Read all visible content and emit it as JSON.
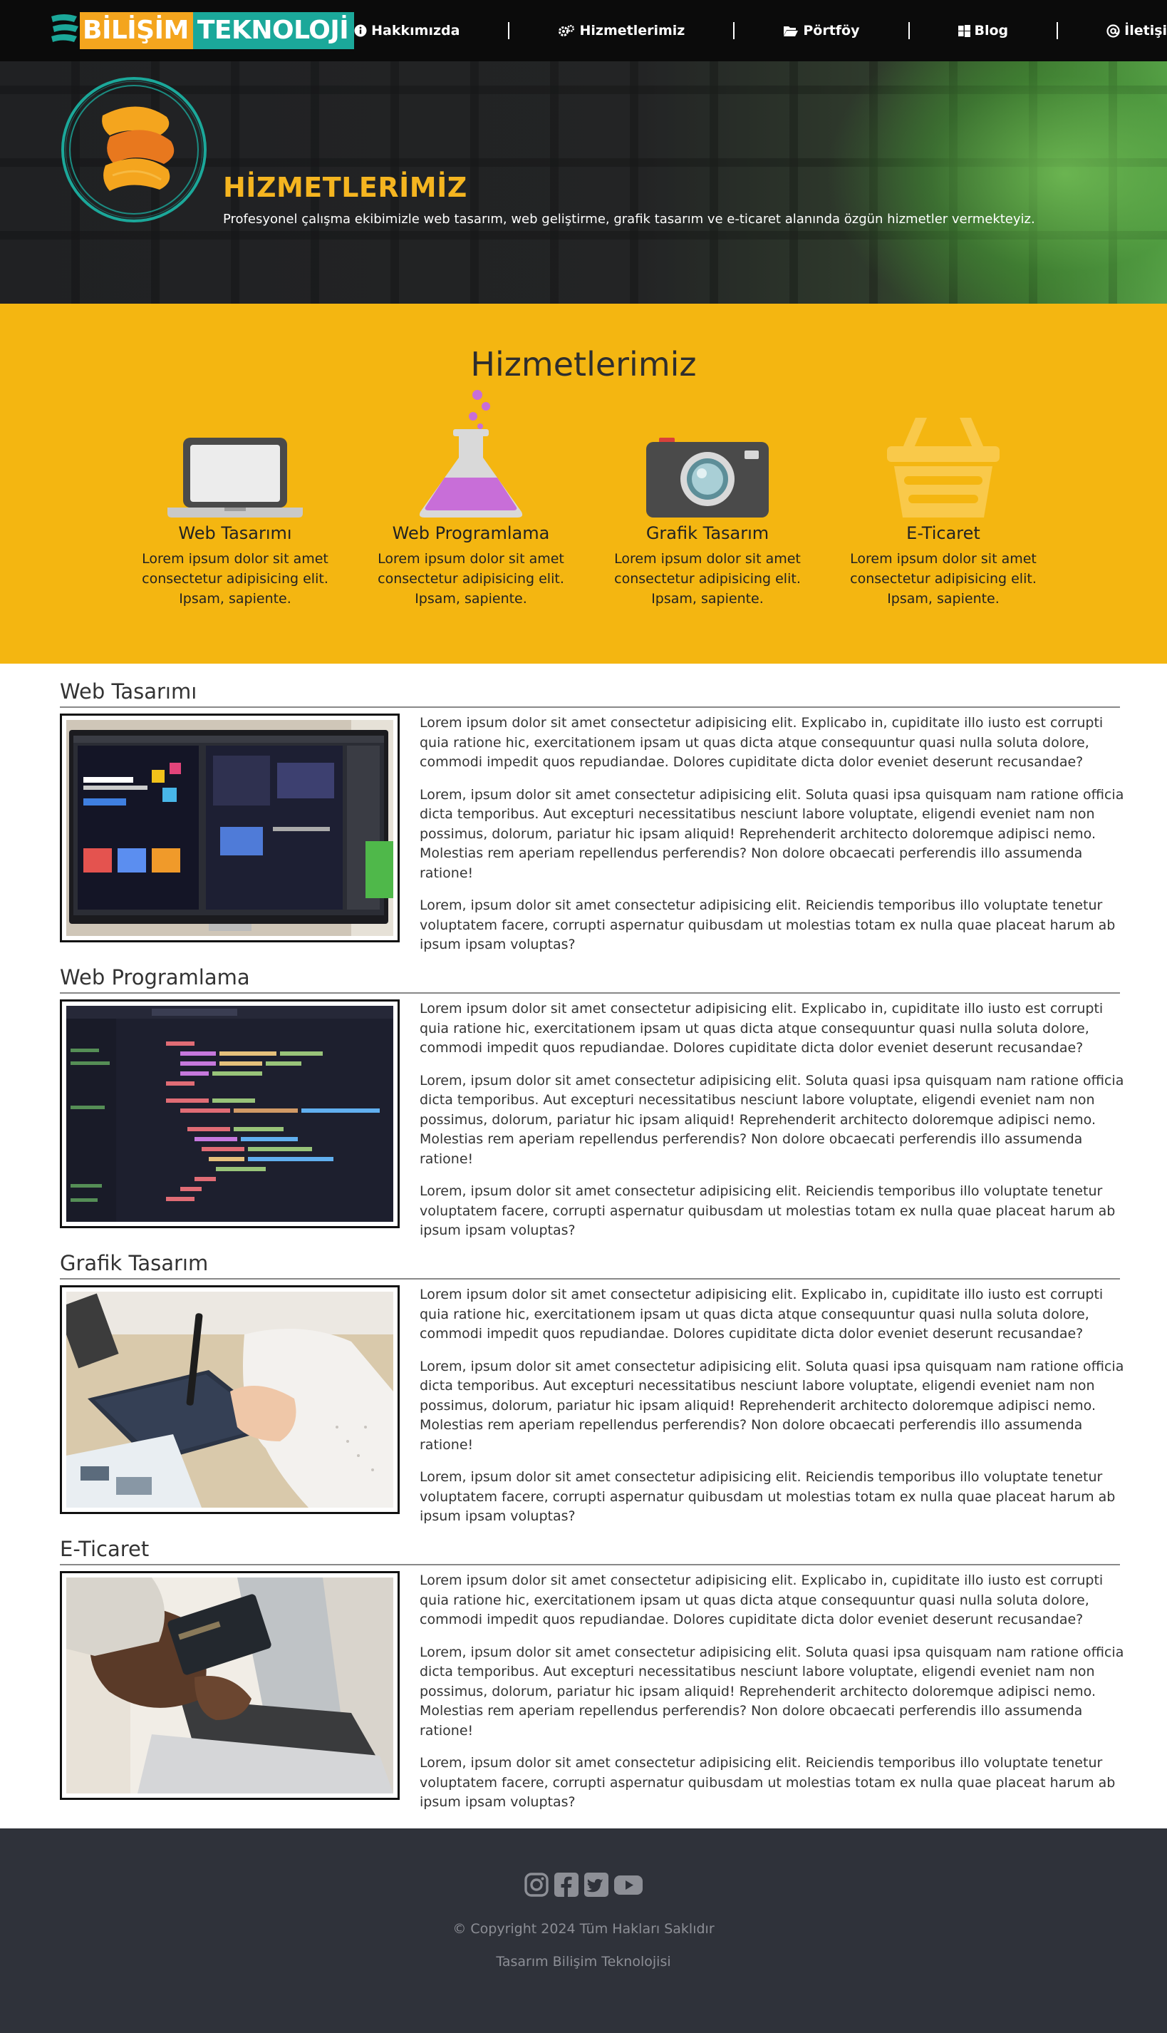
{
  "brand": {
    "logo_part1": "BİLİŞİM",
    "logo_part2": "TEKNOLOJİ",
    "colors": {
      "orange": "#f4a51e",
      "teal": "#1ba89a",
      "yellow": "#f4b611",
      "dark": "#0b0b0b",
      "footer": "#2f323a"
    }
  },
  "nav": {
    "items": [
      {
        "label": "Hakkımızda",
        "icon": "info-circle-icon"
      },
      {
        "label": "Hizmetlerimiz",
        "icon": "gears-icon"
      },
      {
        "label": "Pörtföy",
        "icon": "folder-open-icon"
      },
      {
        "label": "Blog",
        "icon": "windows-icon"
      },
      {
        "label": "İletişim",
        "icon": "at-icon"
      }
    ]
  },
  "hero": {
    "title": "HİZMETLERİMİZ",
    "subtitle": "Profesyonel çalışma ekibimizle web tasarım, web geliştirme, grafik tasarım ve e-ticaret alanında özgün hizmetler vermekteyiz."
  },
  "services": {
    "title": "Hizmetlerimiz",
    "items": [
      {
        "name": "Web Tasarımı",
        "icon": "laptop-icon",
        "desc": "Lorem ipsum dolor sit amet consectetur adipisicing elit. Ipsam, sapiente."
      },
      {
        "name": "Web Programlama",
        "icon": "flask-icon",
        "desc": "Lorem ipsum dolor sit amet consectetur adipisicing elit. Ipsam, sapiente."
      },
      {
        "name": "Grafik Tasarım",
        "icon": "camera-icon",
        "desc": "Lorem ipsum dolor sit amet consectetur adipisicing elit. Ipsam, sapiente."
      },
      {
        "name": "E-Ticaret",
        "icon": "basket-icon",
        "desc": "Lorem ipsum dolor sit amet consectetur adipisicing elit. Ipsam, sapiente."
      }
    ]
  },
  "details": [
    {
      "title": "Web Tasarımı",
      "paragraphs": [
        "Lorem ipsum dolor sit amet consectetur adipisicing elit. Explicabo in, cupiditate illo iusto est corrupti quia ratione hic, exercitationem ipsam ut quas dicta atque consequuntur quasi nulla soluta dolore, commodi impedit quos repudiandae. Dolores cupiditate dicta dolor eveniet deserunt recusandae?",
        "Lorem, ipsum dolor sit amet consectetur adipisicing elit. Soluta quasi ipsa quisquam nam ratione officia dicta temporibus. Aut excepturi necessitatibus nesciunt labore voluptate, eligendi eveniet nam non possimus, dolorum, pariatur hic ipsam aliquid! Reprehenderit architecto doloremque adipisci nemo. Molestias rem aperiam repellendus perferendis? Non dolore obcaecati perferendis illo assumenda ratione!",
        "Lorem, ipsum dolor sit amet consectetur adipisicing elit. Reiciendis temporibus illo voluptate tenetur voluptatem facere, corrupti aspernatur quibusdam ut molestias totam ex nulla quae placeat harum ab ipsum ipsam voluptas?"
      ]
    },
    {
      "title": "Web Programlama",
      "paragraphs": [
        "Lorem ipsum dolor sit amet consectetur adipisicing elit. Explicabo in, cupiditate illo iusto est corrupti quia ratione hic, exercitationem ipsam ut quas dicta atque consequuntur quasi nulla soluta dolore, commodi impedit quos repudiandae. Dolores cupiditate dicta dolor eveniet deserunt recusandae?",
        "Lorem, ipsum dolor sit amet consectetur adipisicing elit. Soluta quasi ipsa quisquam nam ratione officia dicta temporibus. Aut excepturi necessitatibus nesciunt labore voluptate, eligendi eveniet nam non possimus, dolorum, pariatur hic ipsam aliquid! Reprehenderit architecto doloremque adipisci nemo. Molestias rem aperiam repellendus perferendis? Non dolore obcaecati perferendis illo assumenda ratione!",
        "Lorem, ipsum dolor sit amet consectetur adipisicing elit. Reiciendis temporibus illo voluptate tenetur voluptatem facere, corrupti aspernatur quibusdam ut molestias totam ex nulla quae placeat harum ab ipsum ipsam voluptas?"
      ]
    },
    {
      "title": "Grafik Tasarım",
      "paragraphs": [
        "Lorem ipsum dolor sit amet consectetur adipisicing elit. Explicabo in, cupiditate illo iusto est corrupti quia ratione hic, exercitationem ipsam ut quas dicta atque consequuntur quasi nulla soluta dolore, commodi impedit quos repudiandae. Dolores cupiditate dicta dolor eveniet deserunt recusandae?",
        "Lorem, ipsum dolor sit amet consectetur adipisicing elit. Soluta quasi ipsa quisquam nam ratione officia dicta temporibus. Aut excepturi necessitatibus nesciunt labore voluptate, eligendi eveniet nam non possimus, dolorum, pariatur hic ipsam aliquid! Reprehenderit architecto doloremque adipisci nemo. Molestias rem aperiam repellendus perferendis? Non dolore obcaecati perferendis illo assumenda ratione!",
        "Lorem, ipsum dolor sit amet consectetur adipisicing elit. Reiciendis temporibus illo voluptate tenetur voluptatem facere, corrupti aspernatur quibusdam ut molestias totam ex nulla quae placeat harum ab ipsum ipsam voluptas?"
      ]
    },
    {
      "title": "E-Ticaret",
      "paragraphs": [
        "Lorem ipsum dolor sit amet consectetur adipisicing elit. Explicabo in, cupiditate illo iusto est corrupti quia ratione hic, exercitationem ipsam ut quas dicta atque consequuntur quasi nulla soluta dolore, commodi impedit quos repudiandae. Dolores cupiditate dicta dolor eveniet deserunt recusandae?",
        "Lorem, ipsum dolor sit amet consectetur adipisicing elit. Soluta quasi ipsa quisquam nam ratione officia dicta temporibus. Aut excepturi necessitatibus nesciunt labore voluptate, eligendi eveniet nam non possimus, dolorum, pariatur hic ipsam aliquid! Reprehenderit architecto doloremque adipisci nemo. Molestias rem aperiam repellendus perferendis? Non dolore obcaecati perferendis illo assumenda ratione!",
        "Lorem, ipsum dolor sit amet consectetur adipisicing elit. Reiciendis temporibus illo voluptate tenetur voluptatem facere, corrupti aspernatur quibusdam ut molestias totam ex nulla quae placeat harum ab ipsum ipsam voluptas?"
      ]
    }
  ],
  "footer": {
    "social": [
      "instagram-icon",
      "facebook-icon",
      "twitter-icon",
      "youtube-icon"
    ],
    "copyright": "© Copyright 2024 Tüm Hakları Saklıdır",
    "design": "Tasarım Bilişim Teknolojisi"
  }
}
